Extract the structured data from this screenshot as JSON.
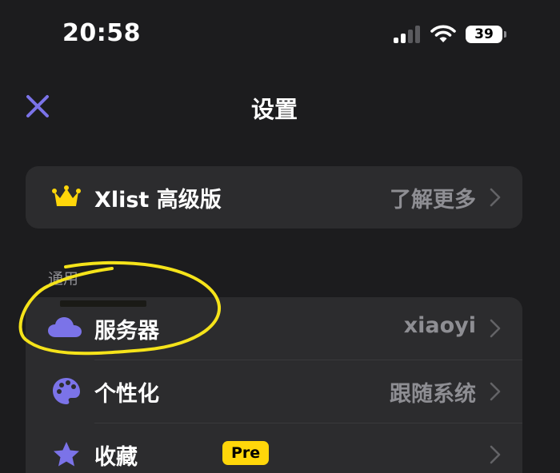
{
  "status_bar": {
    "time": "20:58",
    "battery": "39",
    "icons": [
      "signal-icon",
      "wifi-icon",
      "battery-icon"
    ]
  },
  "nav": {
    "title": "设置",
    "close_icon": "close-icon"
  },
  "premium": {
    "icon": "crown-icon",
    "label": "Xlist 高级版",
    "value": "了解更多"
  },
  "general": {
    "header": "通用",
    "items": [
      {
        "icon": "cloud-icon",
        "label": "服务器",
        "value": "xiaoyi"
      },
      {
        "icon": "palette-icon",
        "label": "个性化",
        "value": "跟随系统"
      },
      {
        "icon": "star-icon",
        "label": "收藏",
        "badge": "Pre",
        "value": ""
      }
    ]
  },
  "colors": {
    "accent": "#7b73e8",
    "background": "#1c1c1e",
    "card": "#2c2c2e",
    "secondary_text": "#8e8e93",
    "crown": "#ffd60a",
    "badge": "#ffd60a",
    "annotation": "#f5e31a"
  }
}
